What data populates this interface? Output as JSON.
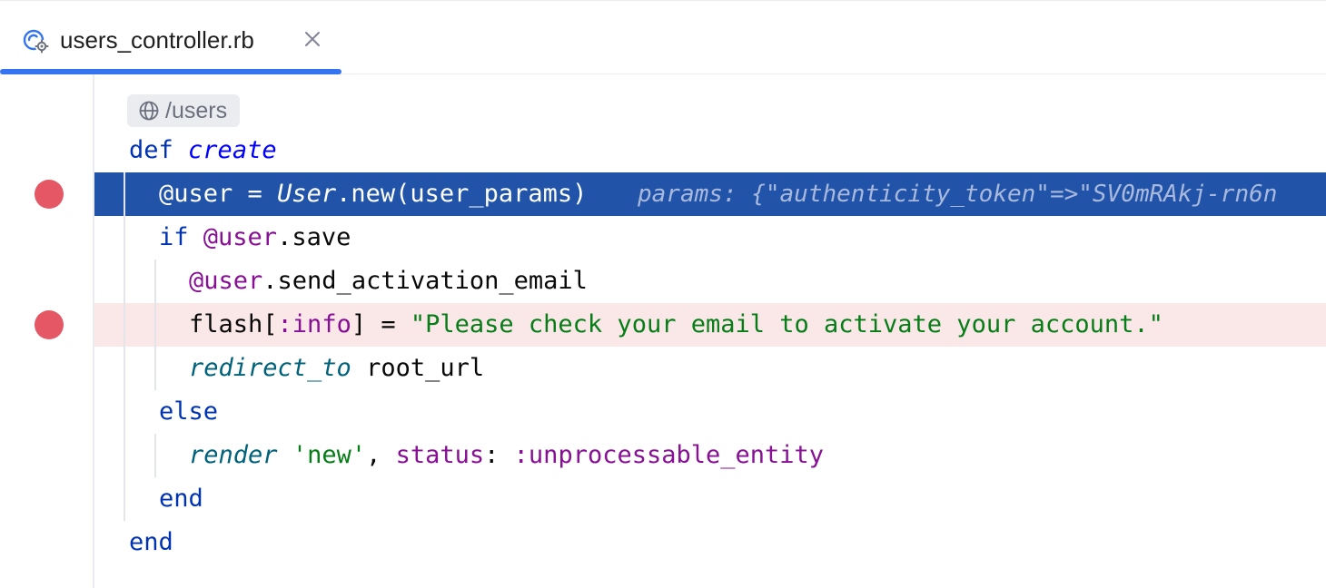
{
  "tab": {
    "filename": "users_controller.rb",
    "icon": "ruby-controller-icon"
  },
  "route": {
    "path": "/users",
    "icon": "globe-icon"
  },
  "code": {
    "l1_def": "def",
    "l1_name": "create",
    "l2_ivar": "@user",
    "l2_assign": " = ",
    "l2_const": "User",
    "l2_call": ".new(user_params)",
    "l2_hint": "params: {\"authenticity_token\"=>\"SV0mRAkj-rn6n",
    "l3_if": "if",
    "l3_ivar": "@user",
    "l3_call": ".save",
    "l4_ivar": "@user",
    "l4_call": ".send_activation_email",
    "l5_flash": "flash[",
    "l5_sym": ":info",
    "l5_assign": "] = ",
    "l5_str": "\"Please check your email to activate your account.\"",
    "l6_meth": "redirect_to",
    "l6_arg": " root_url",
    "l7_else": "else",
    "l8_meth": "render",
    "l8_str": "'new'",
    "l8_comma": ", ",
    "l8_key": "status",
    "l8_colon": ": ",
    "l8_sym": ":unprocessable_entity",
    "l9_end": "end",
    "l10_end": "end"
  },
  "colors": {
    "accent": "#3574f0",
    "execution_line": "#2154a8",
    "breakpoint": "#e55765",
    "breakpoint_line": "#fae7e7"
  }
}
